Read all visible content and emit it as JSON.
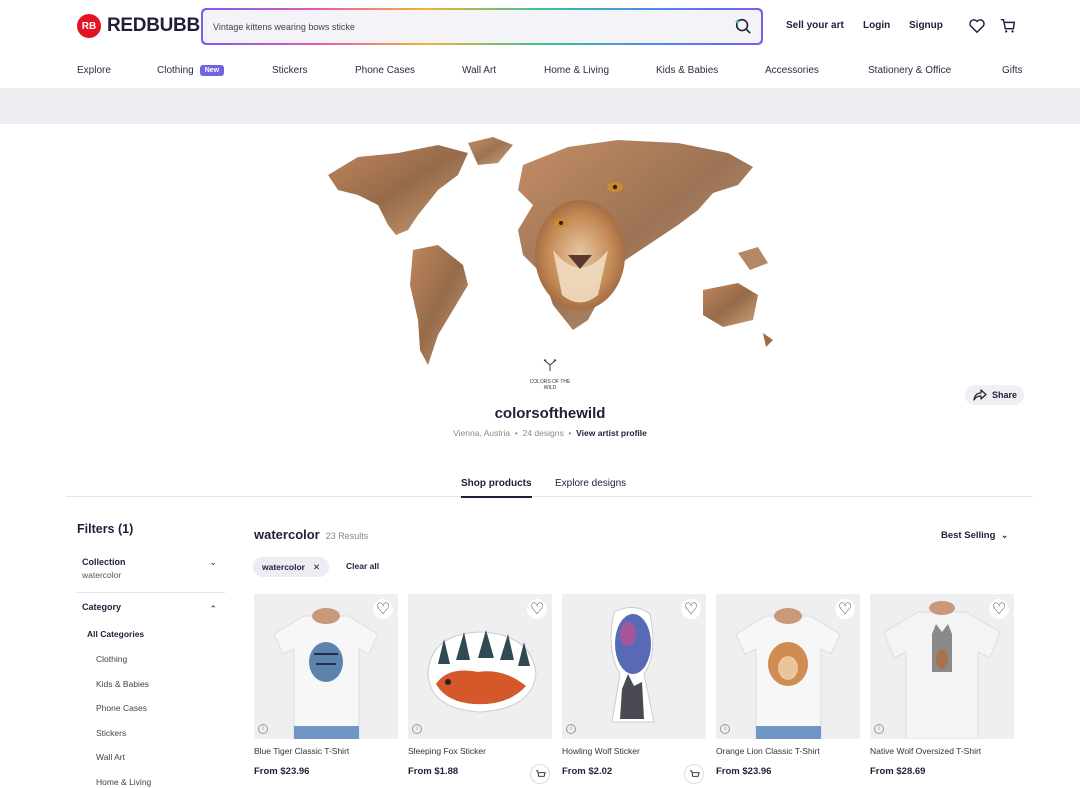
{
  "brand": {
    "logo_mark": "RB",
    "name": "REDBUBBLE",
    "color": "#e41321"
  },
  "search": {
    "value": "Vintage kittens wearing bows sticke",
    "icon": "search-sparkle-icon"
  },
  "header": {
    "sell": "Sell your art",
    "login": "Login",
    "signup": "Signup"
  },
  "nav": {
    "items": [
      "Explore",
      "Clothing",
      "Stickers",
      "Phone Cases",
      "Wall Art",
      "Home & Living",
      "Kids & Babies",
      "Accessories",
      "Stationery & Office",
      "Gifts"
    ],
    "new_badge": "New"
  },
  "artist": {
    "logo_text": "COLORS OF THE WILD",
    "name": "colorsofthewild",
    "location": "Vienna, Austria",
    "designs": "24 designs",
    "profile_link": "View artist profile",
    "share": "Share"
  },
  "tabs": [
    "Shop products",
    "Explore designs"
  ],
  "filters": {
    "title": "Filters (1)",
    "collection_label": "Collection",
    "collection_value": "watercolor",
    "category_label": "Category",
    "all_categories": "All Categories",
    "categories": [
      "Clothing",
      "Kids & Babies",
      "Phone Cases",
      "Stickers",
      "Wall Art",
      "Home & Living"
    ]
  },
  "results": {
    "query": "watercolor",
    "count": "23 Results",
    "sort": "Best Selling",
    "chip": "watercolor",
    "clear_all": "Clear all"
  },
  "products": [
    {
      "title": "Blue Tiger Classic T-Shirt",
      "price": "From $23.96"
    },
    {
      "title": "Sleeping Fox Sticker",
      "price": "From $1.88"
    },
    {
      "title": "Howling Wolf Sticker",
      "price": "From $2.02"
    },
    {
      "title": "Orange Lion Classic T-Shirt",
      "price": "From $23.96"
    },
    {
      "title": "Native Wolf Oversized T-Shirt",
      "price": "From $28.69"
    }
  ]
}
